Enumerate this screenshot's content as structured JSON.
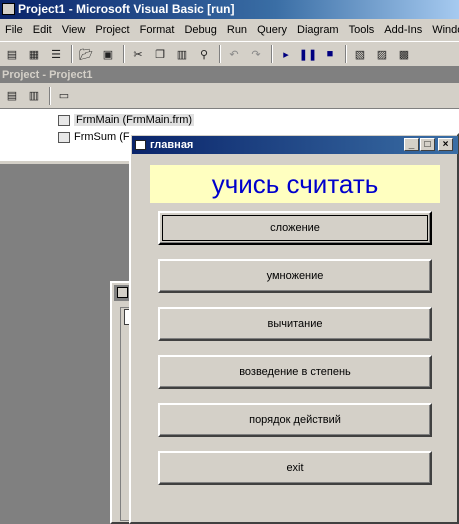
{
  "ide": {
    "title": "Project1 - Microsoft Visual Basic [run]",
    "menu": [
      "File",
      "Edit",
      "View",
      "Project",
      "Format",
      "Debug",
      "Run",
      "Query",
      "Diagram",
      "Tools",
      "Add-Ins",
      "Window"
    ]
  },
  "toolbar": {
    "icons": [
      "add-project-icon",
      "add-form-icon",
      "menu-editor-icon",
      "open-icon",
      "save-icon",
      "cut-icon",
      "copy-icon",
      "paste-icon",
      "find-icon",
      "undo-icon",
      "redo-icon",
      "start-icon",
      "break-icon",
      "end-icon",
      "project-explorer-icon",
      "properties-icon",
      "form-layout-icon"
    ]
  },
  "project_panel": {
    "title": "Project - Project1",
    "items": [
      {
        "label": "FrmMain (FrmMain.frm)"
      },
      {
        "label": "FrmSum (Fr"
      }
    ]
  },
  "main_form": {
    "title": "главная",
    "banner": "учись считать",
    "buttons": [
      {
        "label": "сложение"
      },
      {
        "label": "умножение"
      },
      {
        "label": "вычитание"
      },
      {
        "label": "возведение в степень"
      },
      {
        "label": "порядок действий"
      },
      {
        "label": "exit"
      }
    ],
    "minimize": "_",
    "maximize": "□",
    "close": "×"
  }
}
